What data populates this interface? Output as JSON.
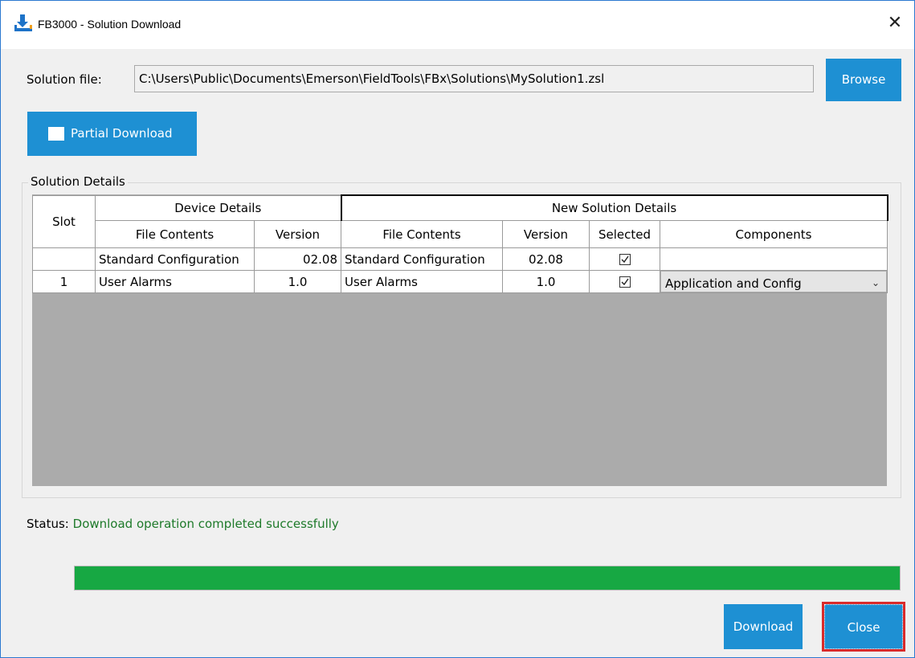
{
  "window": {
    "title": "FB3000 - Solution Download",
    "close_glyph": "✕"
  },
  "solution": {
    "label": "Solution file:",
    "path": "C:\\Users\\Public\\Documents\\Emerson\\FieldTools\\FBx\\Solutions\\MySolution1.zsl",
    "browse_label": "Browse"
  },
  "partial_download": {
    "label": "Partial Download",
    "checked": false
  },
  "details": {
    "group_title": "Solution Details",
    "headers": {
      "slot": "Slot",
      "device_details": "Device Details",
      "new_solution_details": "New Solution Details",
      "file_contents": "File Contents",
      "version": "Version",
      "new_file_contents": "File Contents",
      "new_version": "Version",
      "selected": "Selected",
      "components": "Components"
    },
    "rows": [
      {
        "slot": "",
        "device_file": "Standard Configuration",
        "device_version": "02.08",
        "new_file": "Standard Configuration",
        "new_version": "02.08",
        "selected": true,
        "components": ""
      },
      {
        "slot": "1",
        "device_file": "User Alarms",
        "device_version": "1.0",
        "new_file": "User Alarms",
        "new_version": "1.0",
        "selected": true,
        "components": "Application and Config"
      }
    ]
  },
  "status": {
    "label": "Status:",
    "message": "Download operation completed successfully"
  },
  "progress": {
    "fraction": 1.0
  },
  "buttons": {
    "download": "Download",
    "close": "Close"
  },
  "colors": {
    "accent": "#1e90d3",
    "progress": "#17a843",
    "status_text": "#1e7a2a",
    "highlight": "#d92b2b"
  }
}
